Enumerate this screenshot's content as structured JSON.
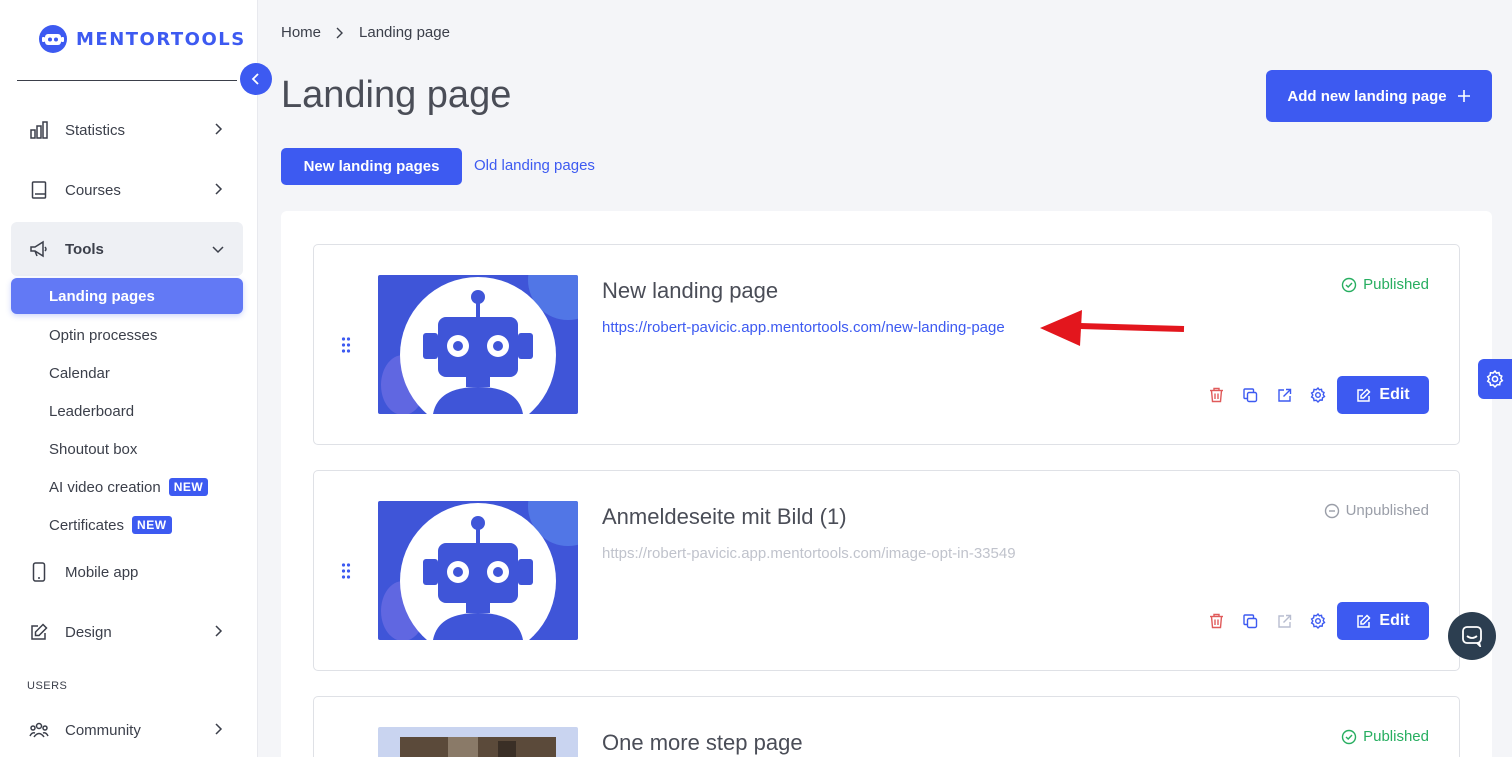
{
  "brand": {
    "name": "MENTORTOOLS",
    "accent": "#3d5af1"
  },
  "sidebar": {
    "items": [
      {
        "label": "Statistics",
        "icon": "bar-chart-icon"
      },
      {
        "label": "Courses",
        "icon": "book-icon"
      },
      {
        "label": "Tools",
        "icon": "megaphone-icon"
      },
      {
        "label": "Mobile app",
        "icon": "phone-icon"
      },
      {
        "label": "Design",
        "icon": "edit-icon"
      },
      {
        "label": "Community",
        "icon": "people-icon"
      }
    ],
    "tools_sub": [
      {
        "label": "Landing pages"
      },
      {
        "label": "Optin processes"
      },
      {
        "label": "Calendar"
      },
      {
        "label": "Leaderboard"
      },
      {
        "label": "Shoutout box"
      },
      {
        "label": "AI video creation",
        "badge": "NEW"
      },
      {
        "label": "Certificates",
        "badge": "NEW"
      }
    ],
    "section_users": "USERS"
  },
  "breadcrumb": {
    "home": "Home",
    "current": "Landing page"
  },
  "page": {
    "title": "Landing page",
    "add_button": "Add new landing page",
    "tab_new": "New landing pages",
    "tab_old": "Old landing pages"
  },
  "cards": [
    {
      "title": "New landing page",
      "url": "https://robert-pavicic.app.mentortools.com/new-landing-page",
      "status": "Published",
      "edit": "Edit"
    },
    {
      "title": "Anmeldeseite mit Bild (1)",
      "url": "https://robert-pavicic.app.mentortools.com/image-opt-in-33549",
      "status": "Unpublished",
      "edit": "Edit"
    },
    {
      "title": "One more step page",
      "status": "Published"
    }
  ]
}
